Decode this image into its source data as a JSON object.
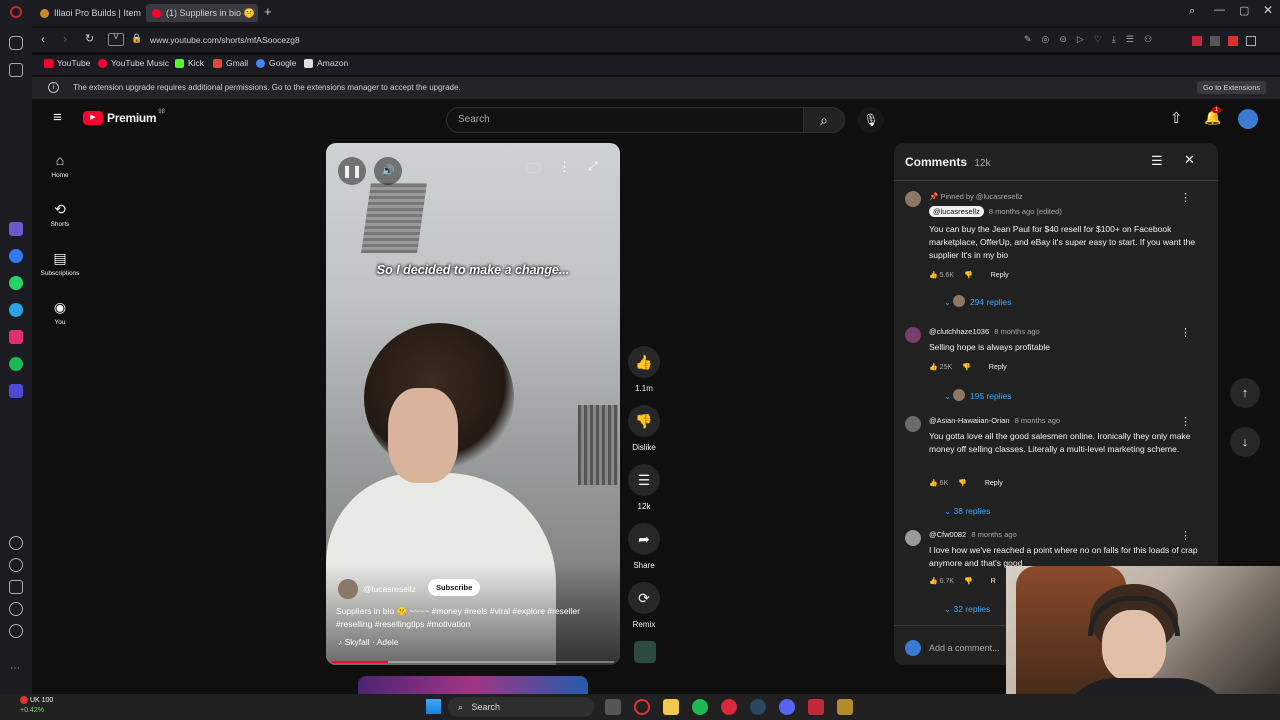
{
  "browser": {
    "tabs": [
      {
        "title": "Illaoi Pro Builds | Item Buil",
        "active": false
      },
      {
        "title": "(1) Suppliers in bio 🤫",
        "active": true
      }
    ],
    "url": "www.youtube.com/shorts/mfASoocezg8",
    "bookmarks": [
      "YouTube",
      "YouTube Music",
      "Kick",
      "Gmail",
      "Google",
      "Amazon"
    ],
    "infobar": {
      "message": "The extension upgrade requires additional permissions. Go to the extensions manager to accept the upgrade.",
      "button": "Go to Extensions"
    }
  },
  "youtube": {
    "logo": "Premium",
    "logo_sup": "98",
    "search_placeholder": "Search",
    "notification_count": "1",
    "nav": [
      {
        "label": "Home",
        "icon": "home-icon",
        "glyph": "⌂"
      },
      {
        "label": "Shorts",
        "icon": "shorts-icon",
        "glyph": "⟲"
      },
      {
        "label": "Subscriptions",
        "icon": "subscriptions-icon",
        "glyph": "▤"
      },
      {
        "label": "You",
        "icon": "you-icon",
        "glyph": "◉"
      }
    ]
  },
  "video": {
    "caption": "So I decided to make a change...",
    "channel": "@lucasresellz",
    "subscribe": "Subscribe",
    "description": "Suppliers in bio 🤫 ~~~~ #money #reels #viral #explore #reseller #reselling #resellingtips #motivation",
    "music": "Skyfall · Adele",
    "progress": 0.2,
    "actions": [
      {
        "name": "like",
        "label": "1.1m",
        "glyph": "👍"
      },
      {
        "name": "dislike",
        "label": "Dislike",
        "glyph": "👎"
      },
      {
        "name": "comments",
        "label": "12k",
        "glyph": "☰"
      },
      {
        "name": "share",
        "label": "Share",
        "glyph": "➦"
      },
      {
        "name": "remix",
        "label": "Remix",
        "glyph": "⟳"
      }
    ]
  },
  "comments": {
    "title": "Comments",
    "count": "12k",
    "add_placeholder": "Add a comment...",
    "items": [
      {
        "pinned": "Pinned by @lucasresellz",
        "author": "@lucasresellz",
        "time": "8 months ago (edited)",
        "text": "You can buy the Jean Paul for $40 resell for $100+ on Facebook marketplace, OfferUp, and eBay it's super easy to start. If you want the supplier It's in my bio",
        "likes": "5.6K",
        "reply": "Reply",
        "replies": "294 replies"
      },
      {
        "author": "@clutchhaze1036",
        "time": "8 months ago",
        "text": "Selling hope is always profitable",
        "likes": "25K",
        "reply": "Reply",
        "replies": "195 replies"
      },
      {
        "author": "@Asian-Hawaiian-Orian",
        "time": "8 months ago",
        "text": "You gotta love all the good salesmen online. Ironically they only make money off selling classes. Literally a multi-level marketing scheme.",
        "likes": "6K",
        "reply": "Reply",
        "replies": "38 replies"
      },
      {
        "author": "@Cfw0082",
        "time": "8 months ago",
        "text": "I love how we've reached a point where no on falls for this loads of crap anymore and that's good",
        "likes": "6.7K",
        "reply": "R",
        "replies": "32 replies"
      }
    ]
  },
  "taskbar": {
    "search": "Search",
    "ticker_name": "UK 100",
    "ticker_change": "+0.42%"
  }
}
